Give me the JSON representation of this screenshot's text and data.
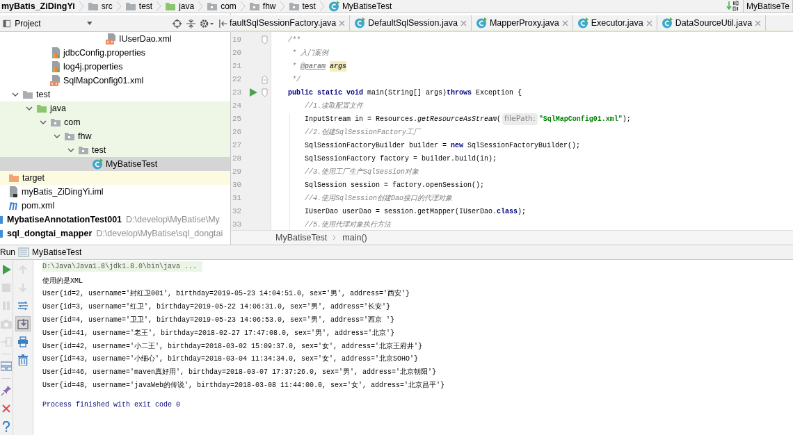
{
  "navbar": {
    "crumbs": [
      {
        "kind": "module",
        "label": "myBatis_ZiDingYi"
      },
      {
        "kind": "folder",
        "label": "src"
      },
      {
        "kind": "folder",
        "label": "test"
      },
      {
        "kind": "test-root",
        "label": "java"
      },
      {
        "kind": "package",
        "label": "com"
      },
      {
        "kind": "package",
        "label": "fhw"
      },
      {
        "kind": "package",
        "label": "test"
      },
      {
        "kind": "class",
        "label": "MyBatiseTest"
      }
    ],
    "run_config": "MyBatiseTe"
  },
  "project_panel": {
    "title": "Project",
    "tree": [
      {
        "children": [
          {
            "children": [
              {
                "children": [
                  {
                    "children": [
                      {
                        "children": [
                          {
                            "children": [
                              {
                                "children": [
                                  {
                                    "children": [
                                      {
                                        "kind": "xml-file",
                                        "label": "IUserDao.xml",
                                        "selected": false
                                      }
                                    ]
                                  }
                                ]
                              }
                            ]
                          }
                        ]
                      },
                      {
                        "kind": "properties-file",
                        "label": "jdbcConfig.properties",
                        "selected": false
                      },
                      {
                        "kind": "properties-file",
                        "label": "log4j.properties",
                        "selected": false
                      },
                      {
                        "kind": "xml-file",
                        "label": "SqlMapConfig01.xml",
                        "selected": false
                      }
                    ]
                  }
                ]
              },
              {
                "kind": "folder",
                "label": "test",
                "expanded": true,
                "selected": false,
                "children": [
                  {
                    "kind": "test-root",
                    "label": "java",
                    "expanded": true,
                    "selected": false,
                    "children": [
                      {
                        "kind": "package",
                        "label": "com",
                        "expanded": true,
                        "selected": false,
                        "children": [
                          {
                            "kind": "package",
                            "label": "fhw",
                            "expanded": true,
                            "selected": false,
                            "children": [
                              {
                                "kind": "package",
                                "label": "test",
                                "expanded": true,
                                "selected": false,
                                "children": [
                                  {
                                    "kind": "class",
                                    "label": "MyBatiseTest",
                                    "selected": true
                                  }
                                ]
                              }
                            ]
                          }
                        ]
                      }
                    ]
                  }
                ]
              }
            ]
          },
          {
            "kind": "excluded",
            "label": "target",
            "selected": false
          },
          {
            "kind": "iml-file",
            "label": "myBatis_ZiDingYi.iml",
            "selected": false
          },
          {
            "kind": "pom-file",
            "label": "pom.xml",
            "selected": false
          }
        ]
      },
      {
        "kind": "module",
        "label": "MybatiseAnnotationTest001",
        "path": "D:\\develop\\MyBatise\\My",
        "selected": false
      },
      {
        "kind": "module",
        "label": "sql_dongtai_mapper",
        "path": "D:\\develop\\MyBatise\\sql_dongtai",
        "selected": false
      }
    ]
  },
  "editor": {
    "tabs": [
      {
        "label": "faultSqlSessionFactory.java",
        "selected": false
      },
      {
        "label": "DefaultSqlSession.java",
        "selected": false
      },
      {
        "label": "MapperProxy.java",
        "selected": false
      },
      {
        "label": "Executor.java",
        "selected": false
      },
      {
        "label": "DataSourceUtil.java",
        "selected": false
      }
    ],
    "lines": [
      {
        "number": "19",
        "kind": "fold-start",
        "segments": [
          {
            "kind": "comment",
            "text": "    /**"
          }
        ]
      },
      {
        "number": "20",
        "segments": [
          {
            "kind": "comment",
            "text": "     * 入门案例"
          }
        ]
      },
      {
        "number": "21",
        "segments": [
          {
            "kind": "comment",
            "text": "     * "
          },
          {
            "kind": "doc-tag",
            "text": "@param"
          },
          {
            "kind": "doc-param",
            "text": "args"
          }
        ]
      },
      {
        "number": "22",
        "kind": "fold-end",
        "segments": [
          {
            "kind": "comment",
            "text": "     */"
          }
        ]
      },
      {
        "number": "23",
        "kind": "run",
        "segments": [
          {
            "kind": "keyword",
            "text": "    public static void "
          },
          {
            "kind": "plain",
            "text": "main(String[] args)"
          },
          {
            "kind": "keyword",
            "text": "throws "
          },
          {
            "kind": "plain",
            "text": "Exception {"
          }
        ]
      },
      {
        "number": "24",
        "segments": [
          {
            "kind": "comment",
            "text": "        //1.读取配置文件"
          }
        ]
      },
      {
        "number": "25",
        "segments": [
          {
            "kind": "plain",
            "text": "        InputStream in = Resources."
          },
          {
            "kind": "static",
            "text": "getResourceAsStream"
          },
          {
            "kind": "plain",
            "text": "("
          },
          {
            "kind": "hint",
            "text": "filePath:"
          },
          {
            "kind": "string",
            "text": "\"SqlMapConfig01.xml\""
          },
          {
            "kind": "plain",
            "text": ");"
          }
        ]
      },
      {
        "number": "26",
        "segments": [
          {
            "kind": "comment",
            "text": "        //2.创建SqlSessionFactory工厂"
          }
        ]
      },
      {
        "number": "27",
        "segments": [
          {
            "kind": "plain",
            "text": "        SqlSessionFactoryBuilder builder = "
          },
          {
            "kind": "keyword",
            "text": "new "
          },
          {
            "kind": "plain",
            "text": "SqlSessionFactoryBuilder();"
          }
        ]
      },
      {
        "number": "28",
        "segments": [
          {
            "kind": "plain",
            "text": "        SqlSessionFactory factory = builder.build(in);"
          }
        ]
      },
      {
        "number": "29",
        "segments": [
          {
            "kind": "comment",
            "text": "        //3.使用工厂生产SqlSession对象"
          }
        ]
      },
      {
        "number": "30",
        "segments": [
          {
            "kind": "plain",
            "text": "        SqlSession session = factory.openSession();"
          }
        ]
      },
      {
        "number": "31",
        "segments": [
          {
            "kind": "comment",
            "text": "        //4.使用SqlSession创建Dao接口的代理对象"
          }
        ]
      },
      {
        "number": "32",
        "segments": [
          {
            "kind": "plain",
            "text": "        IUserDao userDao = session.getMapper(IUserDao."
          },
          {
            "kind": "keyword",
            "text": "class"
          },
          {
            "kind": "plain",
            "text": ");"
          }
        ]
      },
      {
        "number": "33",
        "segments": [
          {
            "kind": "comment",
            "text": "        //5.使用代理对象执行方法"
          }
        ]
      }
    ],
    "breadcrumbs": [
      "MyBatiseTest",
      "main()"
    ]
  },
  "run_panel": {
    "title": "Run",
    "tab": "MyBatiseTest",
    "left_toolbar": [
      {
        "kind": "run",
        "disabled": false
      },
      {
        "kind": "stop",
        "disabled": true
      },
      {
        "kind": "pause",
        "disabled": true
      },
      {
        "kind": "camera",
        "disabled": true
      },
      {
        "kind": "exit",
        "disabled": true
      },
      {
        "kind": "separator"
      },
      {
        "kind": "layout",
        "disabled": false
      },
      {
        "kind": "separator"
      },
      {
        "kind": "pin",
        "disabled": false
      },
      {
        "kind": "close",
        "disabled": false
      },
      {
        "kind": "help",
        "disabled": false
      }
    ],
    "side_toolbar": [
      {
        "kind": "up",
        "disabled": true,
        "pressed": false
      },
      {
        "kind": "down",
        "disabled": true,
        "pressed": false
      },
      {
        "kind": "wrap",
        "disabled": false,
        "pressed": false
      },
      {
        "kind": "scroll-end",
        "disabled": false,
        "pressed": true
      },
      {
        "kind": "print",
        "disabled": false,
        "pressed": false
      },
      {
        "kind": "trash",
        "disabled": false,
        "pressed": false
      }
    ],
    "console": [
      {
        "kind": "command",
        "text": "D:\\Java\\Java1.8\\jdk1.8.0\\bin\\java ..."
      },
      {
        "kind": "output",
        "text": "使用的是XML"
      },
      {
        "kind": "output",
        "text": "User{id=2, username='封红卫001', birthday=2019-05-23 14:04:51.0, sex='男', address='西安'}"
      },
      {
        "kind": "output",
        "text": "User{id=3, username='红卫', birthday=2019-05-22 14:06:31.0, sex='男', address='长安'}"
      },
      {
        "kind": "output",
        "text": "User{id=4, username='卫卫', birthday=2019-05-23 14:06:53.0, sex='男', address='西京 '}"
      },
      {
        "kind": "output",
        "text": "User{id=41, username='老王', birthday=2018-02-27 17:47:08.0, sex='男', address='北京'}"
      },
      {
        "kind": "output",
        "text": "User{id=42, username='小二王', birthday=2018-03-02 15:09:37.0, sex='女', address='北京王府井'}"
      },
      {
        "kind": "output",
        "text": "User{id=43, username='小细心', birthday=2018-03-04 11:34:34.0, sex='女', address='北京SOHO'}"
      },
      {
        "kind": "output",
        "text": "User{id=46, username='maven真好用', birthday=2018-03-07 17:37:26.0, sex='男', address='北京朝阳'}"
      },
      {
        "kind": "output",
        "text": "User{id=48, username='javaWeb的传说', birthday=2018-03-08 11:44:00.0, sex='女', address='北京昌平'}"
      },
      {
        "kind": "exit",
        "text": "Process finished with exit code 0"
      }
    ]
  }
}
